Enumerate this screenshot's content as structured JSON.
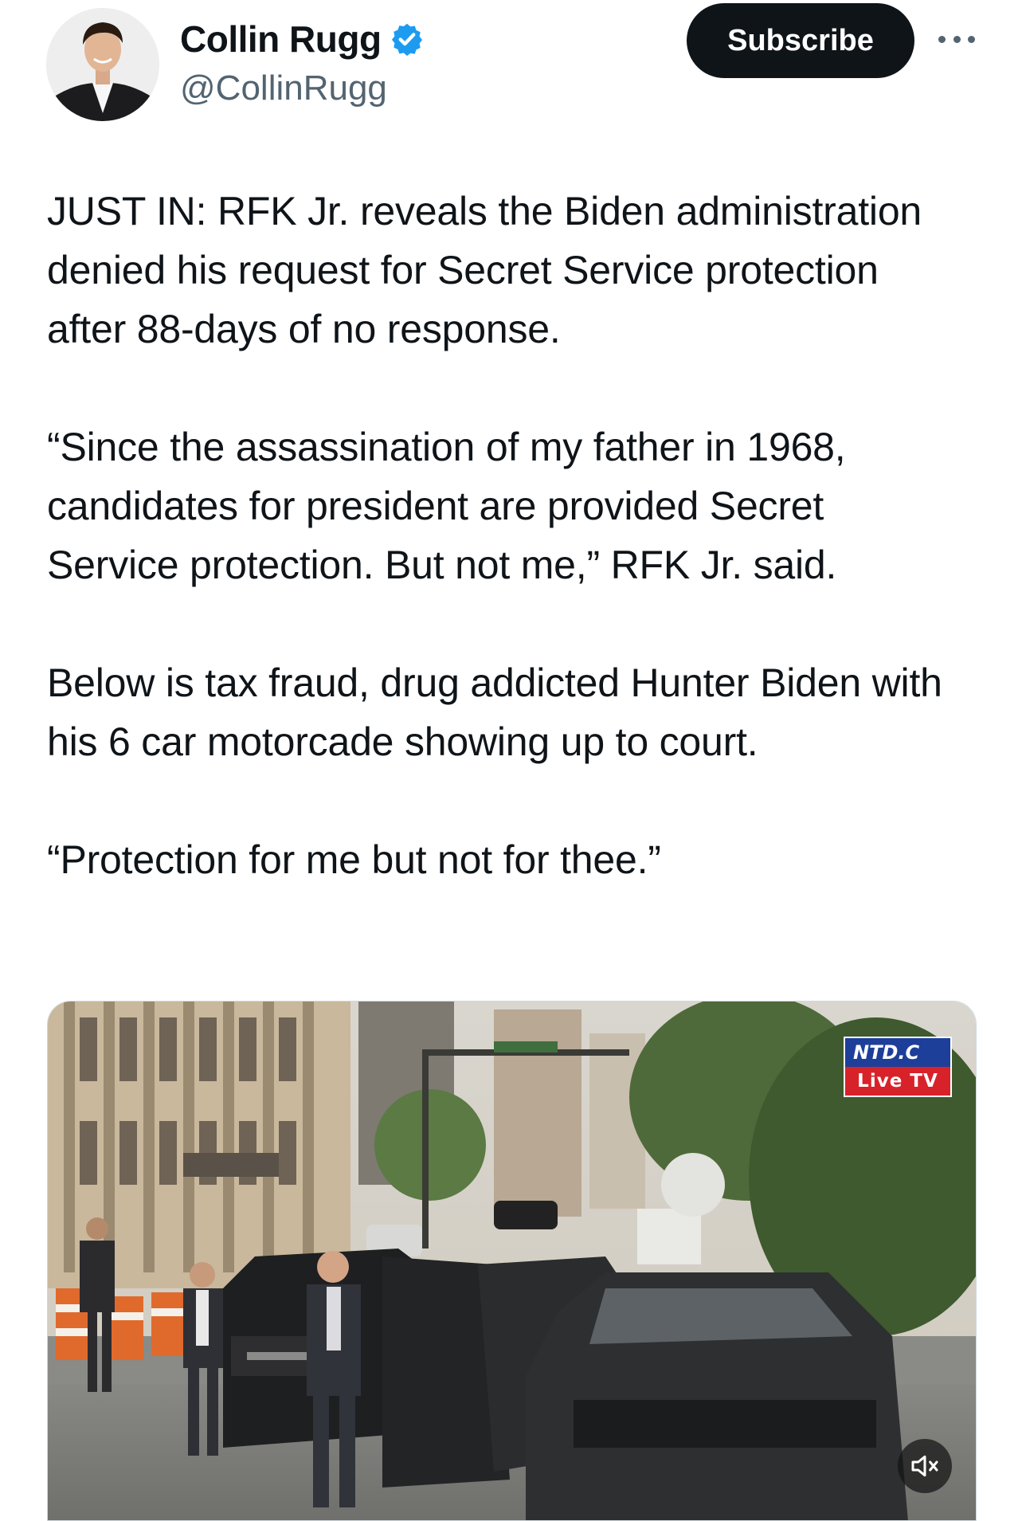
{
  "author": {
    "display_name": "Collin Rugg",
    "handle": "@CollinRugg",
    "verified_icon": "verified-badge-icon"
  },
  "actions": {
    "subscribe_label": "Subscribe",
    "more_icon": "more-options-icon"
  },
  "tweet": {
    "paragraphs": [
      "JUST IN: RFK Jr. reveals the Biden administration denied his request for Secret Service protection after 88-days of no response.",
      "“Since the assassination of my father in 1968, candidates for president are provided Secret Service protection. But not me,” RFK Jr. said.",
      "Below is tax fraud, drug addicted Hunter Biden with his 6 car motorcade showing up to court.",
      "“Protection for me but not for thee.”"
    ]
  },
  "media": {
    "watermark_top": "NTD.C",
    "watermark_bottom": "Live TV",
    "mute_icon": "muted-speaker-icon"
  },
  "colors": {
    "text": "#0f1419",
    "secondary": "#536471",
    "verified": "#1d9bf0",
    "button_bg": "#0f1419",
    "ntd_blue": "#1d3f9a",
    "ntd_red": "#d8222a"
  }
}
